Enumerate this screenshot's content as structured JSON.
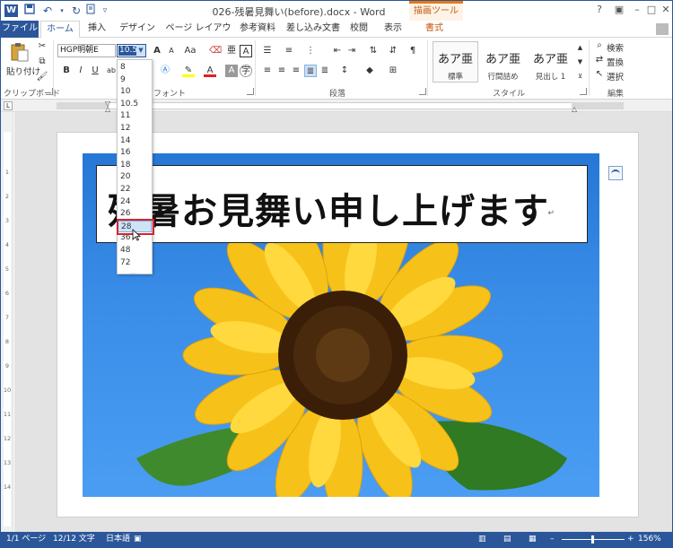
{
  "window": {
    "title": "026-残暑見舞い(before).docx - Word",
    "contextual_group": "描画ツール",
    "app_icon": "W",
    "colors": {
      "accent": "#2b579a",
      "context": "#e77817",
      "highlight": "#d9232e"
    }
  },
  "tabs": [
    {
      "label": "ファイル",
      "type": "file"
    },
    {
      "label": "ホーム",
      "type": "active"
    },
    {
      "label": "挿入"
    },
    {
      "label": "デザイン"
    },
    {
      "label": "ページ レイアウト"
    },
    {
      "label": "参考資料"
    },
    {
      "label": "差し込み文書"
    },
    {
      "label": "校閲"
    },
    {
      "label": "表示"
    },
    {
      "label": "書式"
    }
  ],
  "ribbon": {
    "paste_label": "貼り付け",
    "font_name": "HGP明朝E",
    "font_size": "10.5",
    "groups": {
      "clipboard": "クリップボード",
      "font": "フォント",
      "paragraph": "段落",
      "styles": "スタイル",
      "editing": "編集"
    },
    "styles": [
      {
        "sample": "あア亜",
        "name": "標準"
      },
      {
        "sample": "あア亜",
        "name": "行間詰め"
      },
      {
        "sample": "あア亜",
        "name": "見出し 1"
      }
    ],
    "editing": {
      "find": "検索",
      "replace": "置換",
      "select": "選択"
    },
    "font_buttons": {
      "grow": "A",
      "shrink": "A",
      "change_case": "Aa",
      "bold": "B",
      "italic": "I",
      "underline": "U",
      "font_color": "A",
      "char_shade": "A",
      "ruby": "亜",
      "enclose": "A"
    }
  },
  "font_size_options": [
    "8",
    "9",
    "10",
    "10.5",
    "11",
    "12",
    "14",
    "16",
    "18",
    "20",
    "22",
    "24",
    "26",
    "28",
    "36",
    "48",
    "72"
  ],
  "hovered_font_size": "28",
  "document": {
    "heading": "残暑お見舞い申し上げます",
    "paragraph_mark": "↵"
  },
  "status": {
    "page": "1/1 ページ",
    "words": "12/12 文字",
    "language": "日本語",
    "zoom": "156%"
  },
  "ruler_numbers": [
    "1",
    "2",
    "3",
    "4",
    "5",
    "6",
    "7",
    "8",
    "9",
    "10",
    "11",
    "12",
    "13",
    "14"
  ]
}
